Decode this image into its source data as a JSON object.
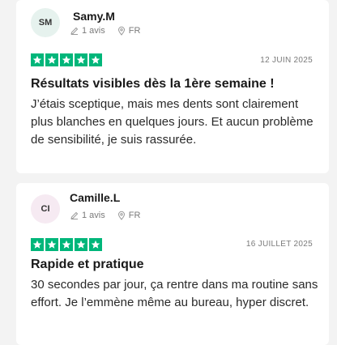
{
  "reviews": [
    {
      "initials": "SM",
      "name": "Samy.M",
      "review_count": "1 avis",
      "country": "FR",
      "date": "12 JUIN 2025",
      "rating": 5,
      "title": "Résultats visibles dès la 1ère semaine !",
      "text": "J’étais sceptique, mais mes dents sont clairement plus blanches en quelques jours. Et aucun problème de sensibilité, je suis rassurée.",
      "avatar_color": "#e6f2ee"
    },
    {
      "initials": "CI",
      "name": "Camille.L",
      "review_count": "1 avis",
      "country": "FR",
      "date": "16 JUILLET 2025",
      "rating": 5,
      "title": "Rapide et pratique",
      "text": "30 secondes par jour, ça rentre dans ma routine sans effort. Je l’emmène même au bureau, hyper discret.",
      "avatar_color": "#f6eaf2"
    }
  ],
  "colors": {
    "star_green": "#00b67a",
    "background": "#f3f3f3"
  },
  "icons": {
    "review_count": "pencil-icon",
    "country": "location-pin-icon",
    "rating": "star-icon"
  }
}
